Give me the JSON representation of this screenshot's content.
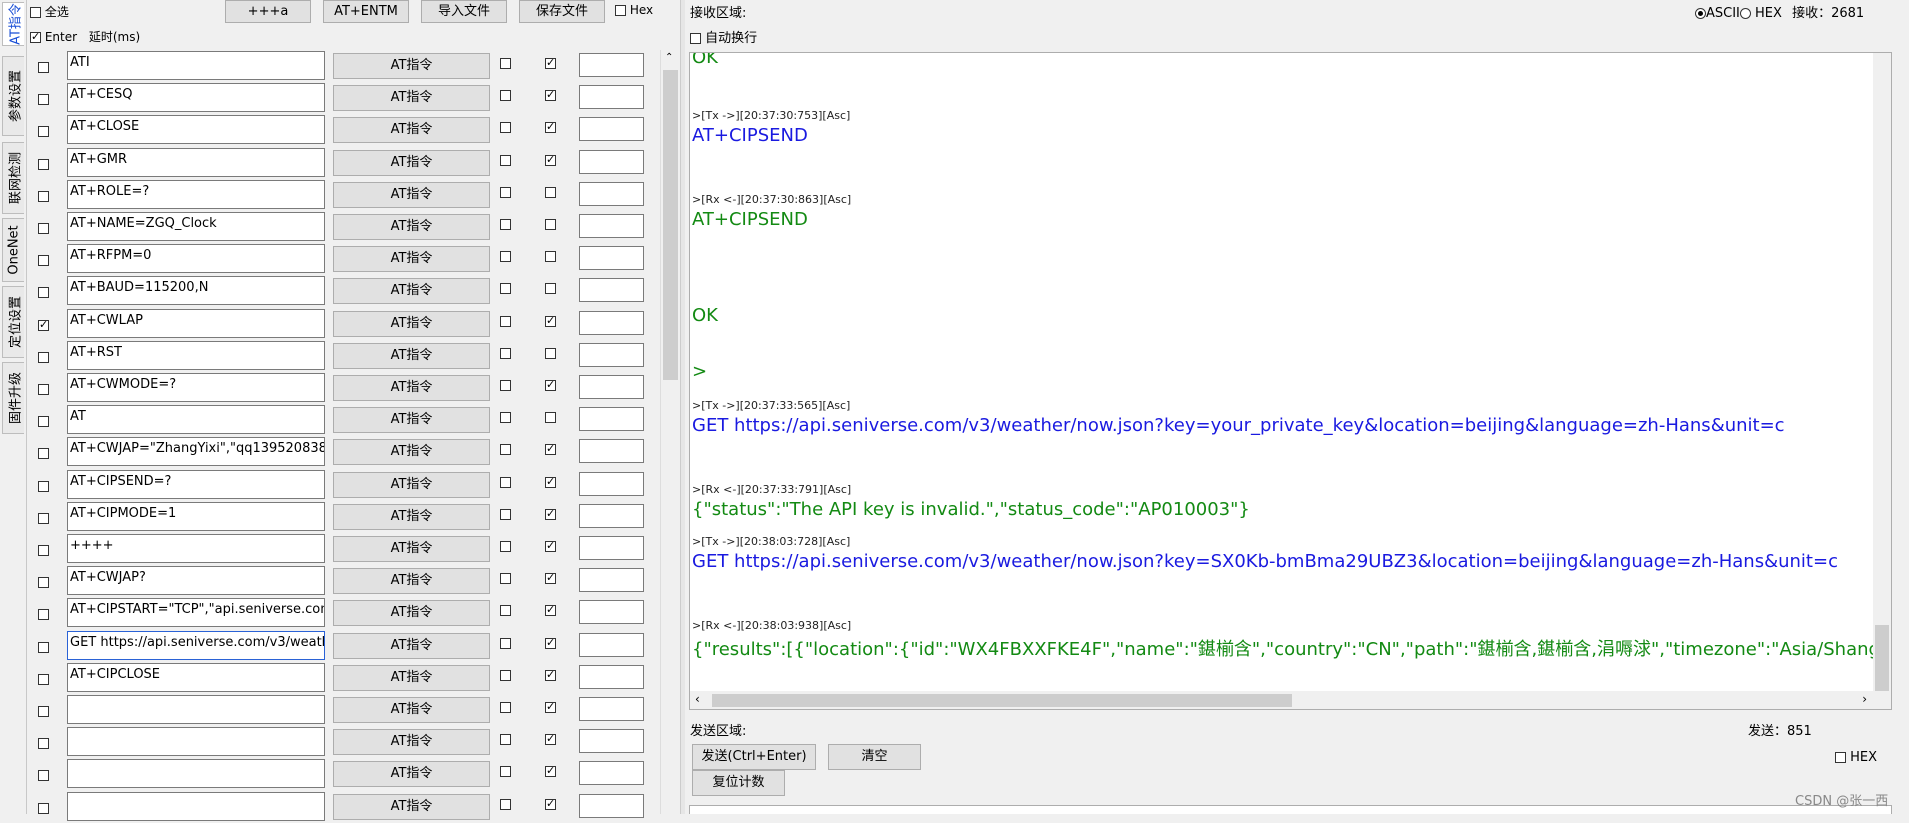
{
  "side_tabs": [
    "AT指令",
    "参数设置",
    "联网检测",
    "OneNet",
    "定位设置",
    "固件升级"
  ],
  "toolbar": {
    "select_all": "全选",
    "btn_plus": "+++a",
    "btn_entm": "AT+ENTM",
    "btn_import": "导入文件",
    "btn_save": "保存文件",
    "hex": "Hex",
    "enter": "Enter",
    "delay": "延时(ms)"
  },
  "at_button_label": "AT指令",
  "commands": [
    {
      "text": "ATI",
      "sel": false,
      "c2": true
    },
    {
      "text": "AT+CESQ",
      "sel": false,
      "c2": true
    },
    {
      "text": "AT+CLOSE",
      "sel": false,
      "c2": true
    },
    {
      "text": "AT+GMR",
      "sel": false,
      "c2": true
    },
    {
      "text": "AT+ROLE=?",
      "sel": false,
      "c2": false
    },
    {
      "text": "AT+NAME=ZGQ_Clock",
      "sel": false,
      "c2": false
    },
    {
      "text": "AT+RFPM=0",
      "sel": false,
      "c2": false
    },
    {
      "text": "AT+BAUD=115200,N",
      "sel": false,
      "c2": false
    },
    {
      "text": "AT+CWLAP",
      "sel": true,
      "c2": true
    },
    {
      "text": "AT+RST",
      "sel": false,
      "c2": false
    },
    {
      "text": "AT+CWMODE=?",
      "sel": false,
      "c2": true
    },
    {
      "text": "AT",
      "sel": false,
      "c2": false
    },
    {
      "text": "AT+CWJAP=\"ZhangYixi\",\"qq139520838",
      "sel": false,
      "c2": true
    },
    {
      "text": "AT+CIPSEND=?",
      "sel": false,
      "c2": true
    },
    {
      "text": "AT+CIPMODE=1",
      "sel": false,
      "c2": true
    },
    {
      "text": "++++",
      "sel": false,
      "c2": true
    },
    {
      "text": "AT+CWJAP?",
      "sel": false,
      "c2": true
    },
    {
      "text": "AT+CIPSTART=\"TCP\",\"api.seniverse.com",
      "sel": false,
      "c2": true
    },
    {
      "text": "GET https://api.seniverse.com/v3/weathe",
      "sel": false,
      "c2": true
    },
    {
      "text": "AT+CIPCLOSE",
      "sel": false,
      "c2": true
    },
    {
      "text": "",
      "sel": false,
      "c2": true
    },
    {
      "text": "",
      "sel": false,
      "c2": true
    },
    {
      "text": "",
      "sel": false,
      "c2": true
    },
    {
      "text": "",
      "sel": false,
      "c2": true
    }
  ],
  "receive": {
    "label": "接收区域:",
    "auto_wrap": "自动换行",
    "ascii": "ASCII",
    "hex": "HEX",
    "count": "接收：2681"
  },
  "log": [
    {
      "kind": "rx",
      "text": "OK"
    },
    {
      "kind": "hdr",
      "text": ">[Tx ->][20:37:30:753][Asc]"
    },
    {
      "kind": "tx",
      "text": "AT+CIPSEND"
    },
    {
      "kind": "hdr",
      "text": ">[Rx <-][20:37:30:863][Asc]"
    },
    {
      "kind": "rx",
      "text": "AT+CIPSEND"
    },
    {
      "kind": "rx",
      "text": "OK"
    },
    {
      "kind": "rx",
      "text": ">"
    },
    {
      "kind": "hdr",
      "text": ">[Tx ->][20:37:33:565][Asc]"
    },
    {
      "kind": "tx",
      "text": "GET https://api.seniverse.com/v3/weather/now.json?key=your_private_key&location=beijing&language=zh-Hans&unit=c"
    },
    {
      "kind": "hdr",
      "text": ">[Rx <-][20:37:33:791][Asc]"
    },
    {
      "kind": "rx",
      "text": "{\"status\":\"The API key is invalid.\",\"status_code\":\"AP010003\"}"
    },
    {
      "kind": "hdr",
      "text": ">[Tx ->][20:38:03:728][Asc]"
    },
    {
      "kind": "tx",
      "text": "GET https://api.seniverse.com/v3/weather/now.json?key=SX0Kb-bmBma29UBZ3&location=beijing&language=zh-Hans&unit=c"
    },
    {
      "kind": "hdr",
      "text": ">[Rx <-][20:38:03:938][Asc]"
    },
    {
      "kind": "rx",
      "text": "{\"results\":[{\"location\":{\"id\":\"WX4FBXXFKE4F\",\"name\":\"鍖椾含\",\"country\":\"CN\",\"path\":\"鍖椾含,鍖椾含,涓嗕浗\",\"timezone\":\"Asia/Shangh"
    }
  ],
  "send": {
    "label": "发送区域:",
    "count": "发送：851",
    "send_btn": "发送(Ctrl+Enter)",
    "clear_btn": "清空",
    "reset_btn": "复位计数",
    "hex": "HEX"
  },
  "watermark": "CSDN @张一西"
}
